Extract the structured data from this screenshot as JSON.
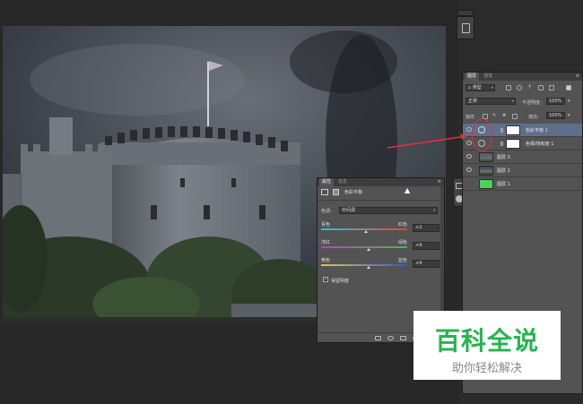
{
  "colors": {
    "panel": "#535353",
    "panel_dark": "#3b3b3b",
    "selected_layer": "#5e6f8b",
    "arrow": "#e0323c",
    "watermark_green": "#27b34f",
    "layer1_fill": "#4fcf5a"
  },
  "layers_panel": {
    "tabs": [
      "图层",
      "通道"
    ],
    "kind_filter": "类型",
    "blend_mode": "正常",
    "opacity_label": "不透明度:",
    "opacity_value": "100%",
    "lock_label": "锁定:",
    "fill_label": "填充:",
    "fill_value": "100%",
    "layers": [
      {
        "name": "色彩平衡 1",
        "type": "adjustment",
        "selected": true,
        "visible": true
      },
      {
        "name": "色相/饱和度 1",
        "type": "adjustment",
        "selected": false,
        "visible": true
      },
      {
        "name": "图层 0",
        "type": "image",
        "selected": false,
        "visible": true
      },
      {
        "name": "图层 2",
        "type": "image",
        "selected": false,
        "visible": true
      },
      {
        "name": "图层 1",
        "type": "fill",
        "selected": false,
        "visible": false
      }
    ]
  },
  "properties_panel": {
    "tabs": [
      "属性",
      "信息"
    ],
    "title": "色彩平衡",
    "tone_label": "色调:",
    "tone_value": "中间调",
    "sliders": [
      {
        "left": "青色",
        "right": "红色",
        "value": "+2"
      },
      {
        "left": "洋红",
        "right": "绿色",
        "value": "+9"
      },
      {
        "left": "黄色",
        "right": "蓝色",
        "value": "+9"
      }
    ],
    "preserve_luminosity": "保留明度",
    "preserve_checked": true
  },
  "watermark": {
    "title": "百科全说",
    "subtitle": "助你轻松解决"
  }
}
